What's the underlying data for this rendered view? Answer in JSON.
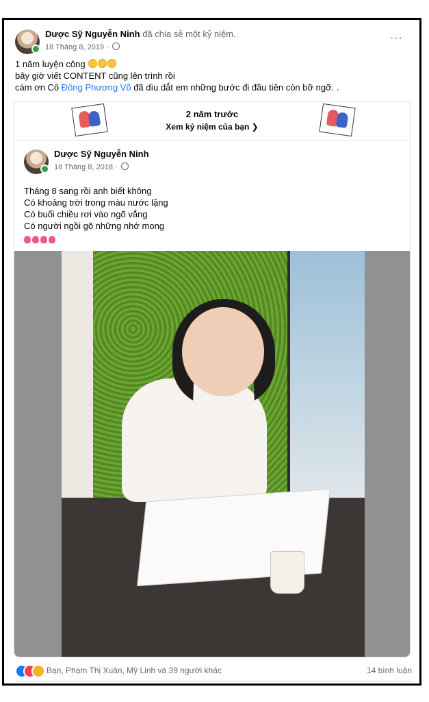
{
  "post": {
    "author": "Dược Sỹ Nguyễn Ninh",
    "action": " đã chia sẻ một kỷ niệm.",
    "date": "18 Tháng 8, 2019 · ",
    "more": "···",
    "lines": [
      "1 năm luyện công ",
      "bây giờ viết CONTENT cũng lên trình rồi",
      "cám ơn Cô "
    ],
    "mention": "Đông Phương Võ",
    "line3_tail": " đã dìu dắt em những bước đi đầu tiên còn bỡ ngỡ. ."
  },
  "memory": {
    "title": "2 năm trước",
    "subtitle": "Xem kỷ niệm của bạn ❯",
    "inner_author": "Dược Sỹ Nguyễn Ninh",
    "inner_date": "18 Tháng 8, 2018 · ",
    "poem": [
      "Tháng 8 sang rồi anh biết không",
      "Có khoảng trời trong màu nước lặng",
      "Có buổi chiều rơi vào ngõ vắng",
      "Có người ngồi gõ những nhớ mong"
    ]
  },
  "footer": {
    "reactions_text": "Bạn, Phạm Thị Xuân, Mỹ Linh và 39 người khác",
    "comments": "14 bình luận"
  }
}
